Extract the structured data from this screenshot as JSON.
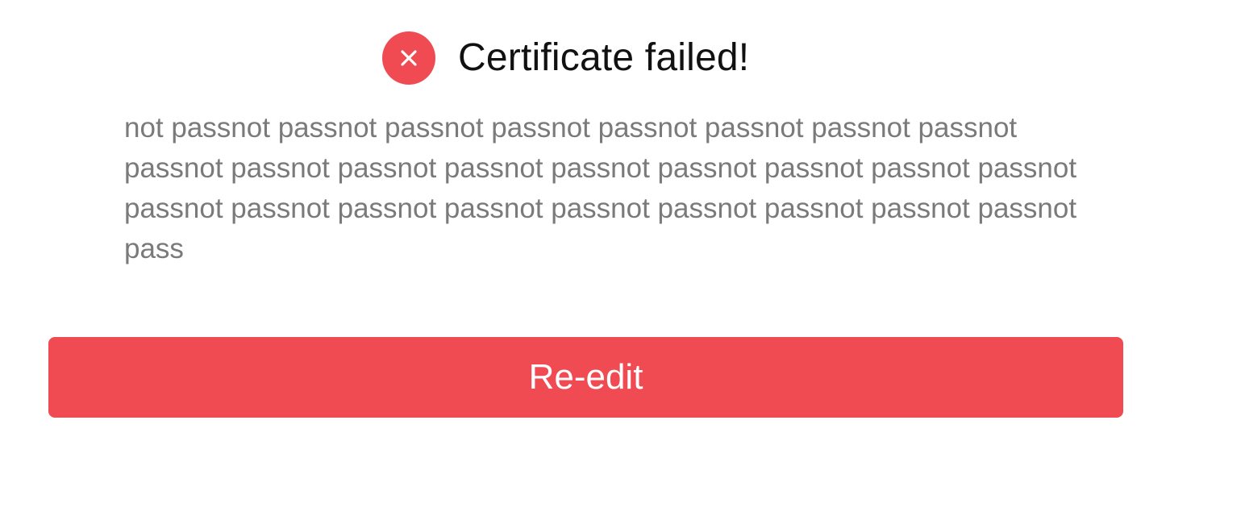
{
  "colors": {
    "error": "#f04a52",
    "title": "#111111",
    "message": "#7a7a7a",
    "button_text": "#ffffff"
  },
  "header": {
    "icon": "close-circle-icon",
    "title": "Certificate failed!"
  },
  "message": "not passnot passnot passnot passnot passnot passnot passnot passnot passnot passnot passnot passnot passnot passnot passnot passnot passnot passnot passnot passnot passnot passnot passnot passnot passnot passnot pass",
  "actions": {
    "reedit_label": "Re-edit"
  }
}
